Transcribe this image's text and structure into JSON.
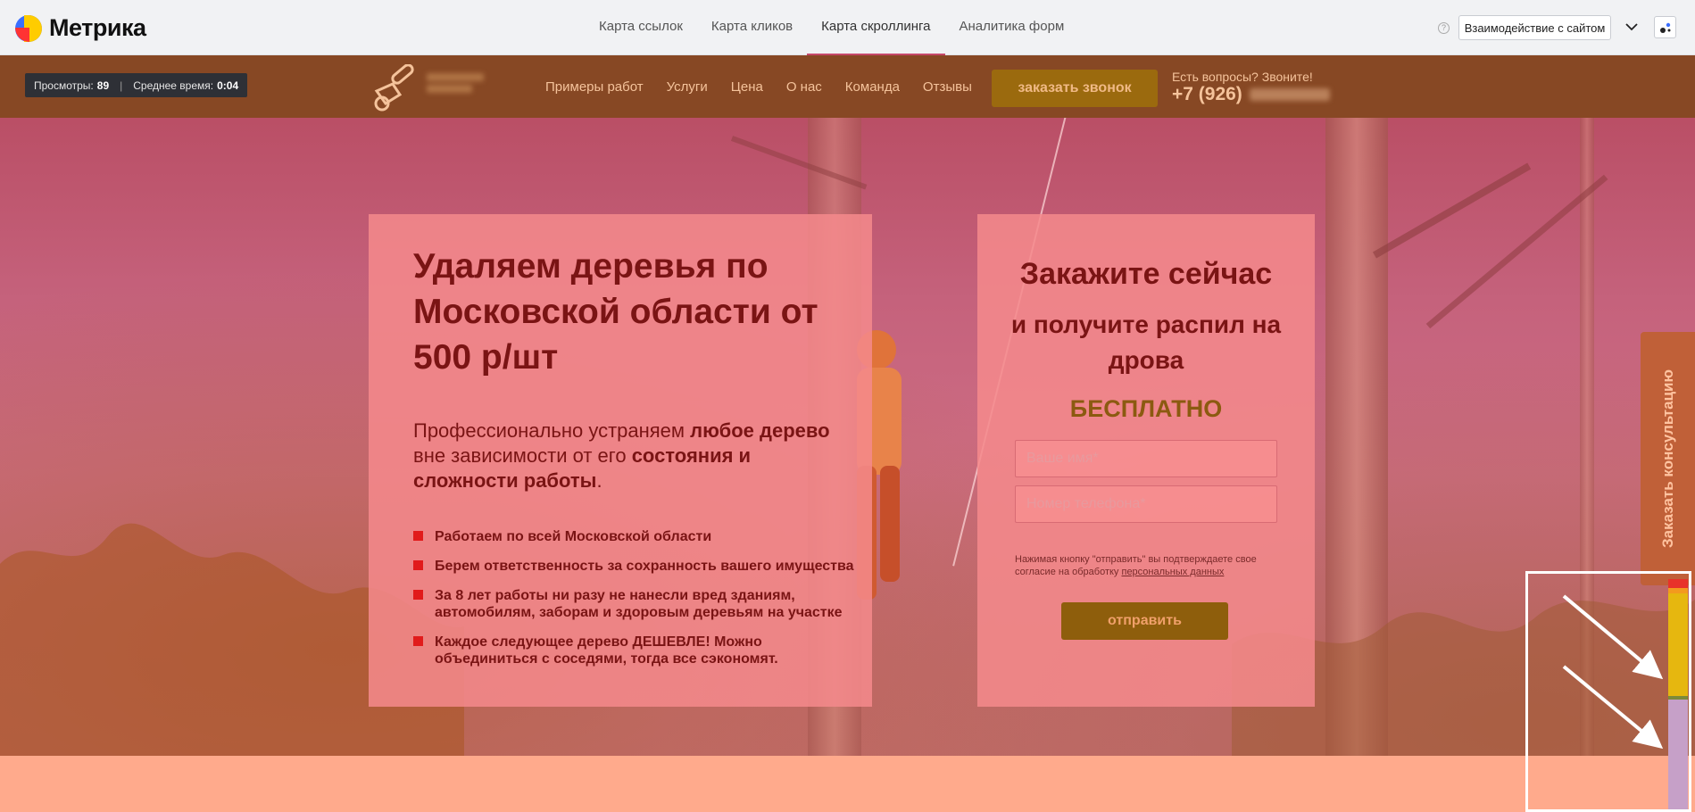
{
  "metrika": {
    "logo_text": "Метрика",
    "tabs": [
      {
        "label": "Карта ссылок"
      },
      {
        "label": "Карта кликов"
      },
      {
        "label": "Карта скроллинга"
      },
      {
        "label": "Аналитика форм"
      }
    ],
    "active_tab_index": 2,
    "help_icon": "?",
    "interact_button": "Взаимодействие с сайтом"
  },
  "stats": {
    "views_label": "Просмотры:",
    "views_value": "89",
    "time_label": "Среднее время:",
    "time_value": "0:04"
  },
  "site_nav": {
    "items": [
      {
        "label": "Примеры работ"
      },
      {
        "label": "Услуги"
      },
      {
        "label": "Цена"
      },
      {
        "label": "О нас"
      },
      {
        "label": "Команда"
      },
      {
        "label": "Отзывы"
      }
    ],
    "call_button": "заказать звонок",
    "ask_text": "Есть вопросы? Звоните!",
    "phone_prefix": "+7 (926)"
  },
  "hero": {
    "title": "Удаляем деревья по Московской области от 500 р/шт",
    "lead_1": "Профессионально устраняем ",
    "lead_b1": "любое дерево",
    "lead_2": " вне зависимости от его ",
    "lead_b2": "состояния и сложности работы",
    "lead_3": ".",
    "bullets": [
      {
        "text": "Работаем по всей Московской области"
      },
      {
        "text": "Берем ответственность за сохранность вашего имущества"
      },
      {
        "text": "За 8 лет работы ни разу не нанесли вред зданиям, автомобилям, заборам и здоровым деревьям на участке"
      },
      {
        "text": "Каждое следующее дерево ДЕШЕВЛЕ! Можно объединиться с соседями, тогда все сэкономят."
      }
    ]
  },
  "form": {
    "title": "Закажите сейчас",
    "subtitle": "и получите распил на дрова",
    "free": "БЕСПЛАТНО",
    "name_placeholder": "Ваше имя*",
    "phone_placeholder": "Номер телефона*",
    "consent_text": "Нажимая кнопку \"отправить\" вы подтверждаете свое согласие на обработку ",
    "consent_link": "персональных данных",
    "submit": "отправить"
  },
  "side_tab": "Заказать консультацию",
  "colors": {
    "metrika_accent": "#c7486a",
    "site_header": "#874824",
    "heat_red": "#e8322a",
    "heat_orange": "#f39a1e",
    "heat_yellow": "#e6b70f",
    "heat_olive": "#7d8a3a",
    "heat_violet": "#c6a0c8"
  }
}
